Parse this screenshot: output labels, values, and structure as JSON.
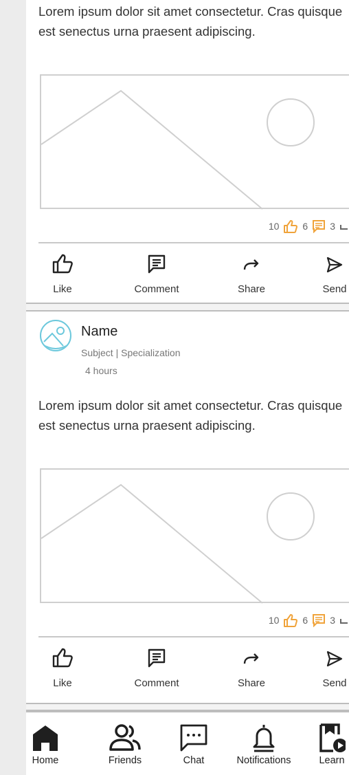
{
  "posts": [
    {
      "text": "Lorem ipsum dolor sit amet consectetur. Cras quisque est senectus urna praesent adipiscing.",
      "stats": {
        "likes": "10",
        "comments": "6",
        "shares": "3"
      }
    },
    {
      "author": {
        "name": "Name",
        "subject": "Subject | Specialization",
        "time": "4 hours"
      },
      "text": "Lorem ipsum dolor sit amet consectetur. Cras quisque est senectus urna praesent adipiscing.",
      "stats": {
        "likes": "10",
        "comments": "6",
        "shares": "3"
      }
    }
  ],
  "actions": {
    "like": "Like",
    "comment": "Comment",
    "share": "Share",
    "send": "Send"
  },
  "nav": {
    "home": "Home",
    "friends": "Friends",
    "chat": "Chat",
    "notifications": "Notifications",
    "learn": "Learn"
  },
  "colors": {
    "like_icon": "#f0a33a",
    "comment_icon": "#f0a33a",
    "avatar_ring": "#6cc8dc"
  },
  "icons": {
    "like": "thumbs-up-icon",
    "comment": "comment-icon",
    "share": "share-arrow-icon",
    "send": "send-icon",
    "home": "home-icon",
    "friends": "friends-icon",
    "chat": "chat-icon",
    "notifications": "bell-icon",
    "learn": "learn-icon"
  }
}
